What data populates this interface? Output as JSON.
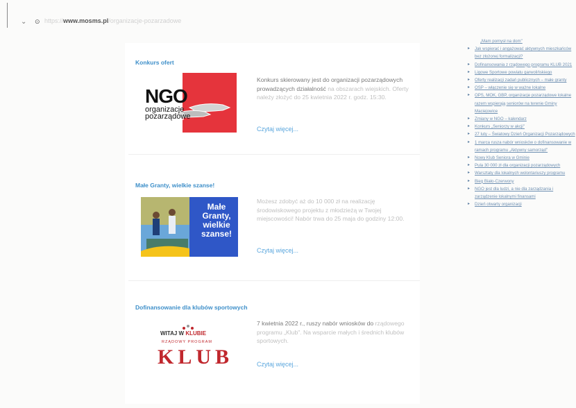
{
  "browser": {
    "url_host": "mosms.pl",
    "url_path": "www.mosms.pl"
  },
  "articles": [
    {
      "title": "Konkurs ofert",
      "image_big": "NGO",
      "image_line1": "organizacje",
      "image_line2": "pozarządowe",
      "description_strong": "Konkurs skierowany jest do organizacji pozarządowych prowadzących działalność",
      "description_rest": " na obszarach wiejskich. Oferty należy złożyć do 25 kwietnia 2022 r. godz. 15:30.",
      "more": "Czytaj więcej..."
    },
    {
      "title": "Małe Granty, wielkie szanse!",
      "image_line1": "Małe",
      "image_line2": "Granty,",
      "image_line3": "wielkie",
      "image_line4": "szanse!",
      "description_strong": "",
      "description_rest": "Możesz zdobyć aż do 10 000 zł na realizację środowiskowego projektu z młodzieżą w Twojej miejscowości! Nabór trwa do 25 maja do godziny 12:00.",
      "more": "Czytaj więcej..."
    },
    {
      "title": "Dofinansowanie dla klubów sportowych",
      "image_small1": "WITAJ W",
      "image_small2": "KLUBIE",
      "image_small3": "RZĄDOWY PROGRAM",
      "image_big": "KLUB",
      "description_strong": "7 kwietnia 2022 r., ruszy nabór wniosków do",
      "description_rest": " rządowego programu „Klub\". Na wsparcie małych i średnich klubów sportowych.",
      "more": "Czytaj więcej..."
    }
  ],
  "sidebar": [
    {
      "text": "„Mam pomysł na dom\"",
      "bullet": ""
    },
    {
      "text": "Jak wspierać i angażować aktywnych mieszkańców bez złożonej formalizacji?",
      "bullet": "▸"
    },
    {
      "text": "Dofinansowania z rządowego programu KLUB 2021",
      "bullet": "▸"
    },
    {
      "text": "Ligowe Sportowe powiatu garwolińskiego",
      "bullet": "▸"
    },
    {
      "text": "Oferty realizacji zadań publicznych – małe granty",
      "bullet": "▸"
    },
    {
      "text": "OSP – włączenie się w ważne lokalne",
      "bullet": "▸"
    },
    {
      "text": "OPS, MOK, GBP, organizacje pozarządowe lokalne razem wspierają seniorów na terenie Gminy Maciejowice",
      "bullet": "▸"
    },
    {
      "text": "Zmiany w NGO – kalendarz",
      "bullet": "▸"
    },
    {
      "text": "Konkurs „Seniorzy w akcji\"",
      "bullet": "▸"
    },
    {
      "text": "27 luty – Światowy Dzień Organizacji Pozarządowych",
      "bullet": "▸"
    },
    {
      "text": "1 marca rusza nabór wniosków o dofinansowanie w ramach programu „Aktywny samorząd\"",
      "bullet": "▸"
    },
    {
      "text": "Nowy Klub Seniora w Gminie",
      "bullet": "▸"
    },
    {
      "text": "Pula 30 000 zł dla organizacji pozarządowych",
      "bullet": "▸"
    },
    {
      "text": "Warsztaty dla lokalnych wolontariuszy programu",
      "bullet": "▸"
    },
    {
      "text": "Bieg Biało-Czerwony",
      "bullet": "▸"
    },
    {
      "text": "NGO jest dla ludzi, a nie dla zarządzania i zarządzenie lokalnymi finansami",
      "bullet": "▸"
    },
    {
      "text": "Dzień otwarty organizacji",
      "bullet": "▸"
    }
  ],
  "colors": {
    "accent": "#3e8fc9",
    "ngo_red": "#e5343c",
    "klub_red": "#c0272d",
    "granty_blue": "#2f57c7",
    "granty_yellow": "#f5c31a"
  }
}
